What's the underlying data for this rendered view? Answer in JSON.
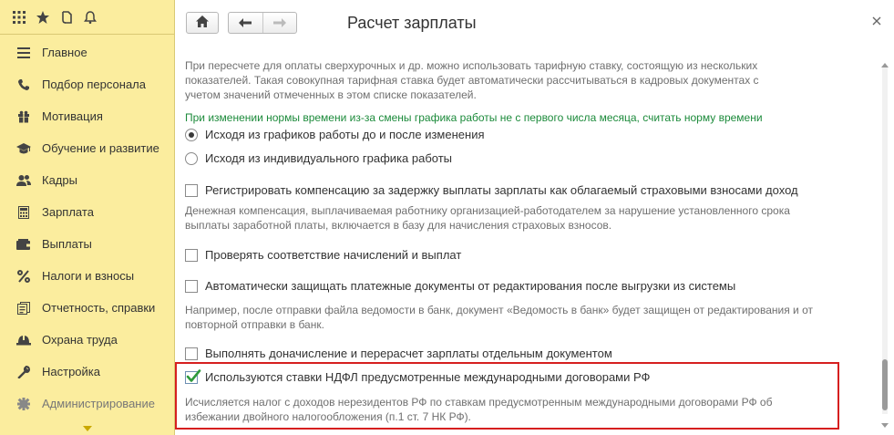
{
  "topbar": {
    "icons": [
      "apps-grid-icon",
      "star-icon",
      "history-icon",
      "bell-icon"
    ]
  },
  "sidebar": {
    "items": [
      {
        "label": "Главное",
        "icon": "menu-icon"
      },
      {
        "label": "Подбор персонала",
        "icon": "phone-icon"
      },
      {
        "label": "Мотивация",
        "icon": "gift-icon"
      },
      {
        "label": "Обучение и развитие",
        "icon": "graduation-cap-icon"
      },
      {
        "label": "Кадры",
        "icon": "people-icon"
      },
      {
        "label": "Зарплата",
        "icon": "calculator-icon"
      },
      {
        "label": "Выплаты",
        "icon": "wallet-icon"
      },
      {
        "label": "Налоги и взносы",
        "icon": "percent-icon"
      },
      {
        "label": "Отчетность, справки",
        "icon": "reports-icon"
      },
      {
        "label": "Охрана труда",
        "icon": "helmet-icon"
      },
      {
        "label": "Настройка",
        "icon": "wrench-icon"
      },
      {
        "label": "Администрирование",
        "icon": "gear-icon"
      }
    ]
  },
  "header": {
    "title": "Расчет зарплаты"
  },
  "content": {
    "intro_note": [
      "При пересчете для оплаты сверхурочных и др. можно использовать тарифную ставку, состоящую из нескольких",
      "показателей. Такая совокупная тарифная ставка будет автоматически рассчитываться в кадровых документах с",
      "учетом значений отмеченных в этом списке показателей."
    ],
    "norm_heading": "При изменении нормы времени из-за смены графика работы не с первого числа месяца, считать норму времени",
    "radio_before_after": "Исходя из графиков работы до и после изменения",
    "radio_individual": "Исходя из индивидуального графика работы",
    "cb_compensation": "Регистрировать компенсацию за задержку выплаты зарплаты как облагаемый страховыми взносами доход",
    "compensation_note": [
      "Денежная компенсация, выплачиваемая работнику организацией-работодателем за нарушение установленного срока",
      "выплаты заработной платы, включается в базу для начисления страховых взносов."
    ],
    "cb_check_accruals": "Проверять соответствие начислений и выплат",
    "cb_protect_docs": "Автоматически защищать платежные документы от редактирования после выгрузки из системы",
    "protect_note": [
      "Например, после отправки файла ведомости в банк, документ «Ведомость в банк» будет защищен от редактирования и от",
      "повторной отправки в банк."
    ],
    "cb_separate_doc": "Выполнять доначисление и перерасчет зарплаты отдельным документом",
    "cb_ndfl_rates": "Используются ставки НДФЛ предусмотренные международными договорами РФ",
    "ndfl_note": [
      "Исчисляется налог с доходов нерезидентов РФ по ставкам предусмотренным международными договорами РФ об",
      "избежании двойного налогообложения (п.1  ст. 7 НК РФ)."
    ]
  },
  "state": {
    "radio_selected": "before_after",
    "cb_compensation": false,
    "cb_check_accruals": false,
    "cb_protect_docs": false,
    "cb_separate_doc": false,
    "cb_ndfl_rates": true
  },
  "colors": {
    "sidebar_bg": "#fbed9e",
    "green_text": "#1b8a3a",
    "highlight": "#d61f1f",
    "check": "#2e9a3c"
  }
}
